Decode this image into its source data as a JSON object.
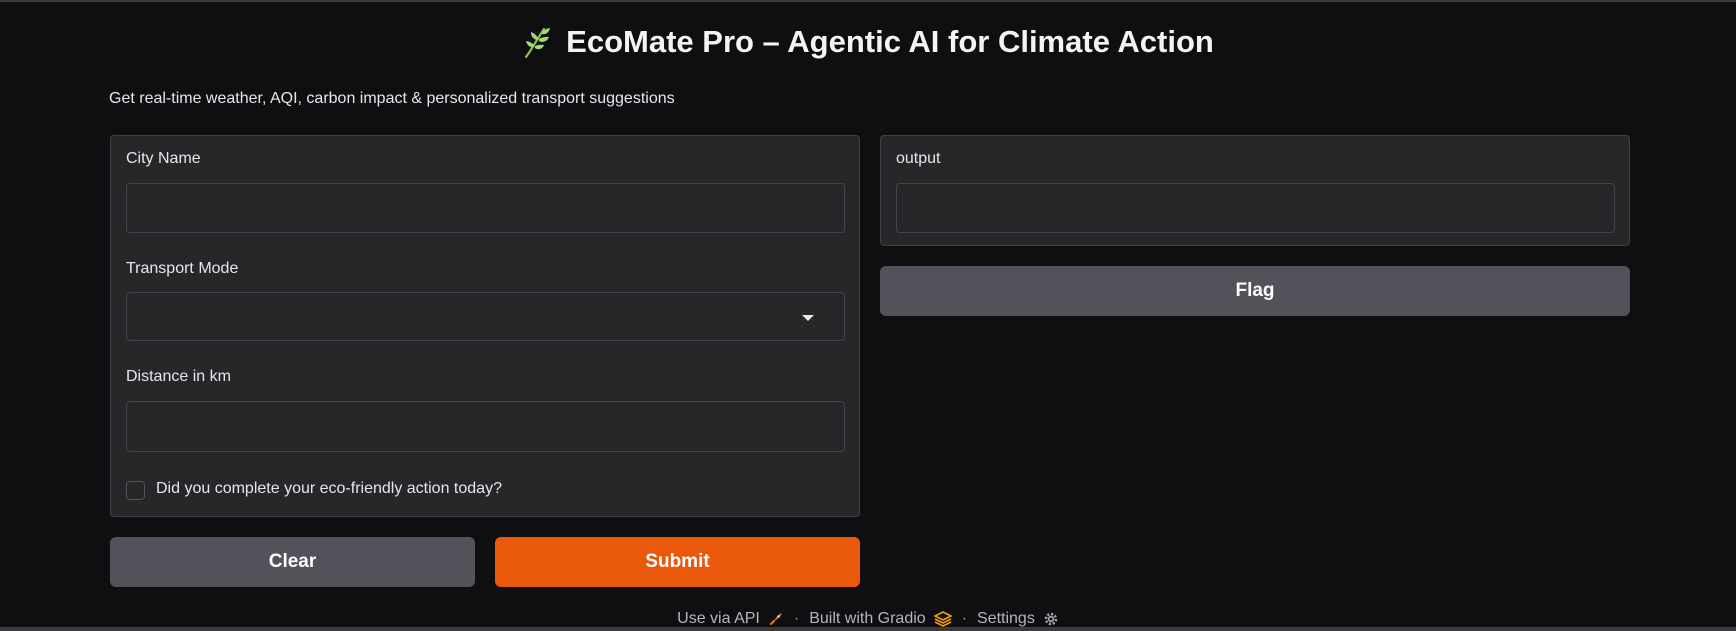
{
  "header": {
    "title": "EcoMate Pro – Agentic AI for Climate Action",
    "subtitle": "Get real-time weather, AQI, carbon impact & personalized transport suggestions",
    "leaf_icon": "leaf-icon"
  },
  "inputs": {
    "city_label": "City Name",
    "city_value": "",
    "transport_label": "Transport Mode",
    "transport_value": "",
    "distance_label": "Distance in km",
    "distance_value": "",
    "checkbox_label": "Did you complete your eco-friendly action today?",
    "checkbox_checked": false
  },
  "output": {
    "label": "output",
    "value": ""
  },
  "buttons": {
    "clear": "Clear",
    "submit": "Submit",
    "flag": "Flag"
  },
  "footer": {
    "api": "Use via API",
    "gradio": "Built with Gradio",
    "settings": "Settings",
    "separator": "·"
  },
  "colors": {
    "background": "#0f0f11",
    "panel": "#27272a",
    "accent_submit": "#ea580c",
    "secondary_button": "#52525b",
    "leaf": "#a3d977"
  }
}
